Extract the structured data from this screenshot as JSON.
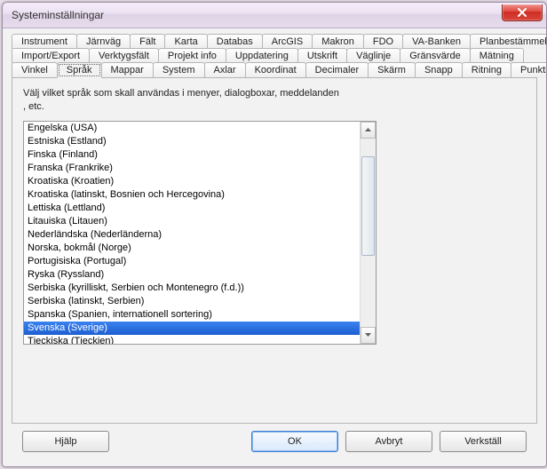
{
  "window": {
    "title": "Systeminställningar"
  },
  "tabs": {
    "row1": [
      "Instrument",
      "Järnväg",
      "Fält",
      "Karta",
      "Databas",
      "ArcGIS",
      "Makron",
      "FDO",
      "VA-Banken",
      "Planbestämmelser"
    ],
    "row2": [
      "Import/Export",
      "Verktygsfält",
      "Projekt info",
      "Uppdatering",
      "Utskrift",
      "Väglinje",
      "Gränsvärde",
      "Mätning"
    ],
    "row3": [
      "Vinkel",
      "Språk",
      "Mappar",
      "System",
      "Axlar",
      "Koordinat",
      "Decimaler",
      "Skärm",
      "Snapp",
      "Ritning",
      "Punktinfo"
    ],
    "selected": "Språk"
  },
  "instruction": "Välj vilket språk som skall användas i menyer, dialogboxar, meddelanden , etc.",
  "languages": [
    "Engelska (USA)",
    "Estniska (Estland)",
    "Finska (Finland)",
    "Franska (Frankrike)",
    "Kroatiska (Kroatien)",
    "Kroatiska (latinskt, Bosnien och Hercegovina)",
    "Lettiska (Lettland)",
    "Litauiska (Litauen)",
    "Nederländska (Nederländerna)",
    "Norska, bokmål (Norge)",
    "Portugisiska (Portugal)",
    "Ryska (Ryssland)",
    "Serbiska (kyrilliskt, Serbien och Montenegro (f.d.))",
    "Serbiska (latinskt, Serbien)",
    "Spanska (Spanien, internationell sortering)",
    "Svenska (Sverige)",
    "Tjeckiska (Tjeckien)"
  ],
  "selected_language": "Svenska (Sverige)",
  "buttons": {
    "help": "Hjälp",
    "ok": "OK",
    "cancel": "Avbryt",
    "apply": "Verkställ"
  }
}
